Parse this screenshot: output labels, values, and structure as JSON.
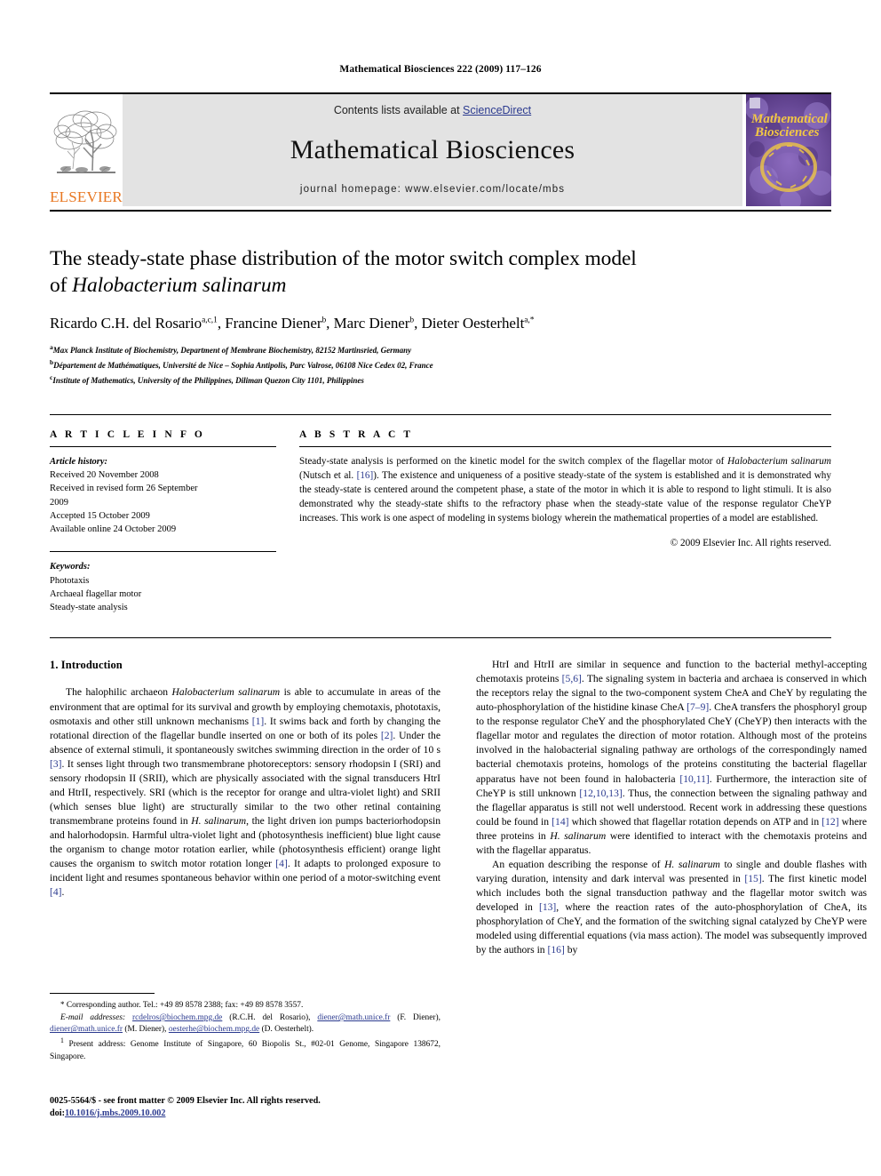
{
  "running_head": "Mathematical Biosciences 222 (2009) 117–126",
  "masthead": {
    "contents_prefix": "Contents lists available at ",
    "sciencedirect": "ScienceDirect",
    "journal_name": "Mathematical Biosciences",
    "homepage": "journal homepage: www.elsevier.com/locate/mbs",
    "publisher_logo_text": "ELSEVIER",
    "cover_title_line1": "Mathematical",
    "cover_title_line2": "Biosciences",
    "cover_bg": "#6e4f9e",
    "cover_text_color": "#f2c744"
  },
  "article": {
    "title_line1": "The steady-state phase distribution of the motor switch complex model",
    "title_line2_prefix": "of ",
    "title_line2_italic": "Halobacterium salinarum",
    "authors": "Ricardo C.H. del Rosario a,c,1, Francine Diener b, Marc Diener b, Dieter Oesterhelt a,*",
    "authors_parts": [
      {
        "name": "Ricardo C.H. del Rosario",
        "sup": "a,c,1"
      },
      {
        "name": "Francine Diener",
        "sup": "b"
      },
      {
        "name": "Marc Diener",
        "sup": "b"
      },
      {
        "name": "Dieter Oesterhelt",
        "sup": "a,*"
      }
    ],
    "affiliations": [
      {
        "mark": "a",
        "text": "Max Planck Institute of Biochemistry, Department of Membrane Biochemistry, 82152 Martinsried, Germany"
      },
      {
        "mark": "b",
        "text": "Département de Mathématiques, Université de Nice – Sophia Antipolis, Parc Valrose, 06108 Nice Cedex 02, France"
      },
      {
        "mark": "c",
        "text": "Institute of Mathematics, University of the Philippines, Diliman Quezon City 1101, Philippines"
      }
    ]
  },
  "article_info": {
    "heading": "A R T I C L E  I N F O",
    "history_label": "Article history:",
    "history": [
      "Received 20 November 2008",
      "Received in revised form 26 September",
      "2009",
      "Accepted 15 October 2009",
      "Available online 24 October 2009"
    ],
    "keywords_label": "Keywords:",
    "keywords": [
      "Phototaxis",
      "Archaeal flagellar motor",
      "Steady-state analysis"
    ]
  },
  "abstract": {
    "heading": "A B S T R A C T",
    "part1": "Steady-state analysis is performed on the kinetic model for the switch complex of the flagellar motor of ",
    "species": "Halobacterium salinarum",
    "part2": " (Nutsch et al. ",
    "ref16": "[16]",
    "part3": "). The existence and uniqueness of a positive steady-state of the system is established and it is demonstrated why the steady-state is centered around the competent phase, a state of the motor in which it is able to respond to light stimuli. It is also demonstrated why the steady-state shifts to the refractory phase when the steady-state value of the response regulator CheYP increases. This work is one aspect of modeling in systems biology wherein the mathematical properties of a model are established.",
    "copyright": "© 2009 Elsevier Inc. All rights reserved."
  },
  "introduction": {
    "heading": "1. Introduction",
    "left_paragraph": {
      "s1": "The halophilic archaeon ",
      "species1": "Halobacterium salinarum",
      "s2": " is able to accumulate in areas of the environment that are optimal for its survival and growth by employing chemotaxis, phototaxis, osmotaxis and other still unknown mechanisms ",
      "r1": "[1]",
      "s3": ". It swims back and forth by changing the rotational direction of the flagellar bundle inserted on one or both of its poles ",
      "r2": "[2]",
      "s4": ". Under the absence of external stimuli, it spontaneously switches swimming direction in the order of 10 s ",
      "r3": "[3]",
      "s5": ". It senses light through two transmembrane photoreceptors: sensory rhodopsin I (SRI) and sensory rhodopsin II (SRII), which are physically associated with the signal transducers HtrI and HtrII, respectively. SRI (which is the receptor for orange and ultra-violet light) and SRII (which senses blue light) are structurally similar to the two other retinal containing transmembrane proteins found in ",
      "species2": "H. salinarum",
      "s6": ", the light driven ion pumps bacteriorhodopsin and halorhodopsin. Harmful ultra-violet light and (photosynthesis inefficient) blue light cause the organism to change motor rotation earlier, while (photosynthesis efficient) orange light causes the organism to switch motor rotation longer ",
      "r4": "[4]",
      "s7": ". It adapts to prolonged exposure to incident light and resumes spontaneous behavior within one period of a motor-switching event ",
      "r5": "[4]",
      "s8": "."
    },
    "right_paragraph1": {
      "s1": "HtrI and HtrII are similar in sequence and function to the bacterial methyl-accepting chemotaxis proteins ",
      "r1": "[5,6]",
      "s2": ". The signaling system in bacteria and archaea is conserved in which the receptors relay the signal to the two-component system CheA and CheY by regulating the auto-phosphorylation of the histidine kinase CheA ",
      "r2": "[7–9]",
      "s3": ". CheA transfers the phosphoryl group to the response regulator CheY and the phosphorylated CheY (CheYP) then interacts with the flagellar motor and regulates the direction of motor rotation. Although most of the proteins involved in the halobacterial signaling pathway are orthologs of the correspondingly named bacterial chemotaxis proteins, homologs of the proteins constituting the bacterial flagellar apparatus have not been found in halobacteria ",
      "r3": "[10,11]",
      "s4": ". Furthermore, the interaction site of CheYP is still unknown ",
      "r4": "[12,10,13]",
      "s5": ". Thus, the connection between the signaling pathway and the flagellar apparatus is still not well understood. Recent work in addressing these questions could be found in ",
      "r5": "[14]",
      "s6": " which showed that flagellar rotation depends on ATP and in ",
      "r6": "[12]",
      "s7": " where three proteins in ",
      "species1": "H. salinarum",
      "s8": " were identified to interact with the chemotaxis proteins and with the flagellar apparatus."
    },
    "right_paragraph2": {
      "s1": "An equation describing the response of ",
      "species1": "H. salinarum",
      "s2": " to single and double flashes with varying duration, intensity and dark interval was presented in ",
      "r1": "[15]",
      "s3": ". The first kinetic model which includes both the signal transduction pathway and the flagellar motor switch was developed in ",
      "r2": "[13]",
      "s4": ", where the reaction rates of the auto-phosphorylation of CheA, its phosphorylation of CheY, and the formation of the switching signal catalyzed by CheYP were modeled using differential equations (via mass action). The model was subsequently improved by the authors in ",
      "r3": "[16]",
      "s5": " by"
    }
  },
  "footnotes": {
    "corresponding": "Corresponding author. Tel.: +49 89 8578 2388; fax: +49 89 8578 3557.",
    "email_label": "E-mail addresses:",
    "emails": [
      {
        "addr": "rcdelros@biochem.mpg.de",
        "who": " (R.C.H. del Rosario), "
      },
      {
        "addr": "diener@math.unice.fr",
        "who": " (F. Diener), "
      },
      {
        "addr": "diener@math.unice.fr",
        "who": " (M. Diener), "
      },
      {
        "addr": "oesterhe@biochem.mpg.de",
        "who": " (D. Oesterhelt)."
      }
    ],
    "present_address_mark": "1",
    "present_address": "Present address: Genome Institute of Singapore, 60 Biopolis St., #02-01 Genome, Singapore 138672, Singapore."
  },
  "page_footer": {
    "issn_line": "0025-5564/$ - see front matter © 2009 Elsevier Inc. All rights reserved.",
    "doi_label": "doi:",
    "doi": "10.1016/j.mbs.2009.10.002"
  }
}
